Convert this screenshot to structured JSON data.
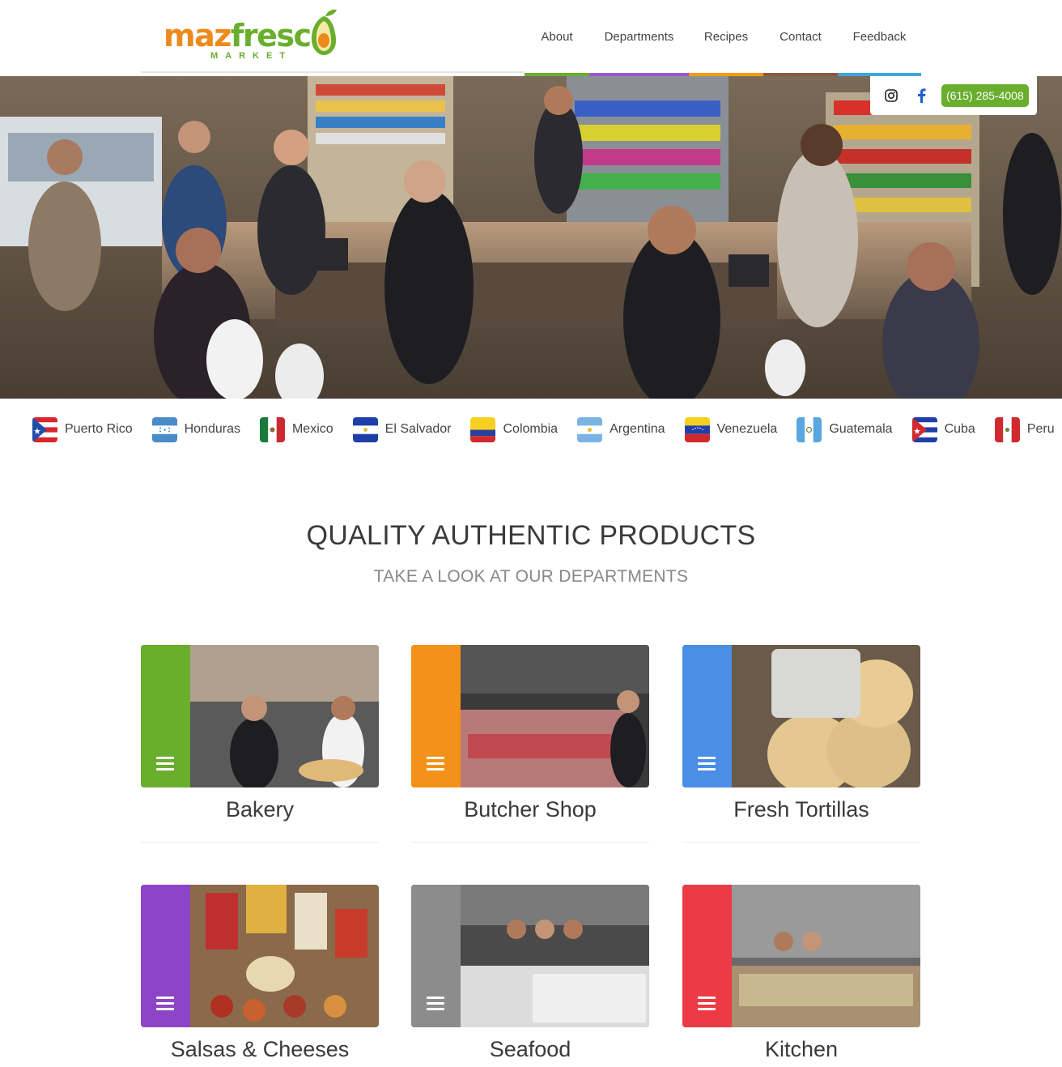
{
  "brand": {
    "logo_word_part1": "maz",
    "logo_word_part2": "fresc",
    "logo_sub": "MARKET",
    "green": "#6aae2d",
    "orange": "#ec8a1b"
  },
  "nav": {
    "items": [
      {
        "label": "About",
        "color": "#6aae2d"
      },
      {
        "label": "Departments",
        "color": "#9b59d0"
      },
      {
        "label": "Recipes",
        "color": "#f39c12"
      },
      {
        "label": "Contact",
        "color": "#8b5a3c"
      },
      {
        "label": "Feedback",
        "color": "#3ba6d8"
      }
    ]
  },
  "social": {
    "icons": [
      "instagram-icon",
      "facebook-icon"
    ],
    "phone": "(615) 285-4008"
  },
  "countries": [
    {
      "name": "Puerto Rico",
      "flag": "flag-puerto-rico-icon"
    },
    {
      "name": "Honduras",
      "flag": "flag-honduras-icon"
    },
    {
      "name": "Mexico",
      "flag": "flag-mexico-icon"
    },
    {
      "name": "El Salvador",
      "flag": "flag-el-salvador-icon"
    },
    {
      "name": "Colombia",
      "flag": "flag-colombia-icon"
    },
    {
      "name": "Argentina",
      "flag": "flag-argentina-icon"
    },
    {
      "name": "Venezuela",
      "flag": "flag-venezuela-icon"
    },
    {
      "name": "Guatemala",
      "flag": "flag-guatemala-icon"
    },
    {
      "name": "Cuba",
      "flag": "flag-cuba-icon"
    },
    {
      "name": "Peru",
      "flag": "flag-peru-icon"
    }
  ],
  "section": {
    "title": "QUALITY AUTHENTIC PRODUCTS",
    "subtitle": "TAKE A LOOK AT OUR DEPARTMENTS"
  },
  "departments": [
    {
      "name": "Bakery",
      "color": "#6aae2d"
    },
    {
      "name": "Butcher Shop",
      "color": "#f39218"
    },
    {
      "name": "Fresh Tortillas",
      "color": "#4a8ee6"
    },
    {
      "name": "Salsas & Cheeses",
      "color": "#8e44c6"
    },
    {
      "name": "Seafood",
      "color": "#8c8c8c"
    },
    {
      "name": "Kitchen",
      "color": "#ec3b45"
    }
  ]
}
